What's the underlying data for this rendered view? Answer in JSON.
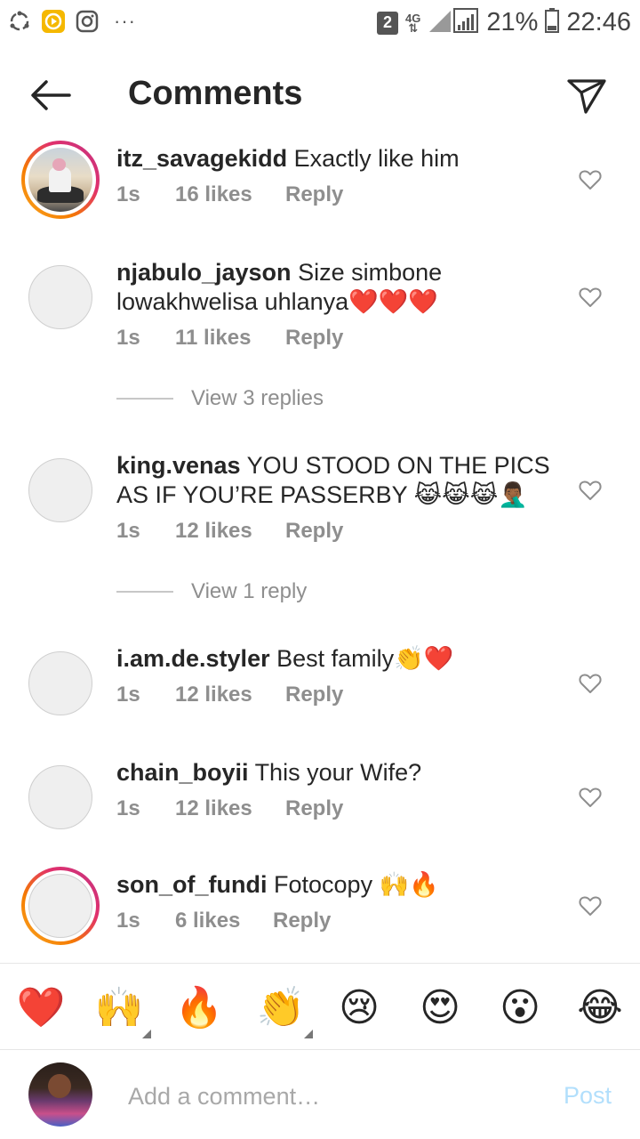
{
  "status_bar": {
    "left_icons": [
      "sync-icon",
      "play-app-icon",
      "instagram-icon"
    ],
    "more": "···",
    "sim_badge": "2",
    "network": "4G",
    "battery_percent": "21%",
    "time": "22:46"
  },
  "header": {
    "title": "Comments",
    "back_icon": "arrow-left-icon",
    "share_icon": "paper-plane-icon"
  },
  "comments": [
    {
      "user": "itz_savagekidd",
      "text": "Exactly like him",
      "time": "1s",
      "likes": "16 likes",
      "reply": "Reply",
      "story_ring": true,
      "photo": true
    },
    {
      "user": "njabulo_jayson",
      "text": "Size simbone lowakhwelisa uhlanya❤️❤️❤️",
      "time": "1s",
      "likes": "11 likes",
      "reply": "Reply",
      "story_ring": false,
      "photo": false
    },
    {
      "user": "king.venas",
      "text": "YOU STOOD ON THE PICS AS IF YOU’RE PASSERBY 😹😹😹🤦🏾‍♂️",
      "time": "1s",
      "likes": "12 likes",
      "reply": "Reply",
      "story_ring": false,
      "photo": false
    },
    {
      "user": "i.am.de.styler",
      "text": "Best family👏❤️",
      "time": "1s",
      "likes": "12 likes",
      "reply": "Reply",
      "story_ring": false,
      "photo": false
    },
    {
      "user": "chain_boyii",
      "text": "This your Wife?",
      "time": "1s",
      "likes": "12 likes",
      "reply": "Reply",
      "story_ring": false,
      "photo": false
    },
    {
      "user": "son_of_fundi",
      "text": "Fotocopy 🙌🔥",
      "time": "1s",
      "likes": "6 likes",
      "reply": "Reply",
      "story_ring": true,
      "photo": false
    }
  ],
  "view_replies": [
    {
      "after_comment": 1,
      "label": "View 3 replies"
    },
    {
      "after_comment": 2,
      "label": "View 1 reply"
    }
  ],
  "emoji_bar": [
    "❤️",
    "🙌",
    "🔥",
    "👏",
    "😢",
    "😍",
    "😮",
    "😂"
  ],
  "input": {
    "placeholder": "Add a comment…",
    "post_label": "Post"
  },
  "colors": {
    "text": "#262626",
    "muted": "#8e8e8e",
    "post_disabled": "#b2dffc",
    "story_ring_start": "#f9a825",
    "story_ring_end": "#c13584"
  }
}
